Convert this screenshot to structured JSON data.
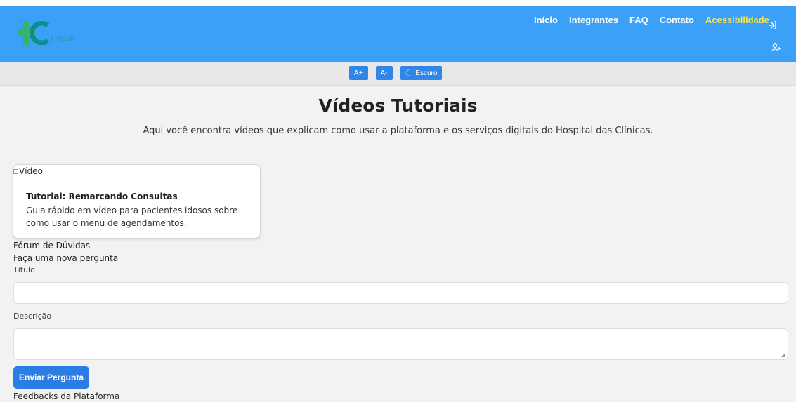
{
  "header": {
    "logo_text": "FMUSP",
    "nav": [
      {
        "label": "Início"
      },
      {
        "label": "Integrantes"
      },
      {
        "label": "FAQ"
      },
      {
        "label": "Contato"
      },
      {
        "label": "Acessibilidade",
        "active": true
      }
    ],
    "icons": {
      "login": "login-icon",
      "register": "add-user-icon"
    }
  },
  "accessibility": {
    "increase_label": "A+",
    "decrease_label": "A-",
    "dark_label": "Escuro"
  },
  "page": {
    "title": "Vídeos Tutoriais",
    "subtitle": "Aqui você encontra vídeos que explicam como usar a plataforma e os serviços digitais do Hospital das Clínicas."
  },
  "video_card": {
    "image_alt": "Vídeo",
    "title": "Tutorial: Remarcando Consultas",
    "description": "Guia rápido em vídeo para pacientes idosos sobre como usar o menu de agendamentos."
  },
  "forum": {
    "heading": "Fórum de Dúvidas",
    "subheading": "Faça uma nova pergunta",
    "title_label": "Título",
    "title_value": "",
    "description_label": "Descrição",
    "description_value": "",
    "submit_label": "Enviar Pergunta"
  },
  "feedback": {
    "heading": "Feedbacks da Plataforma"
  },
  "colors": {
    "header_bg": "#3aa0f8",
    "accent_link": "#f7e34b",
    "primary_button": "#2c7ce6"
  }
}
